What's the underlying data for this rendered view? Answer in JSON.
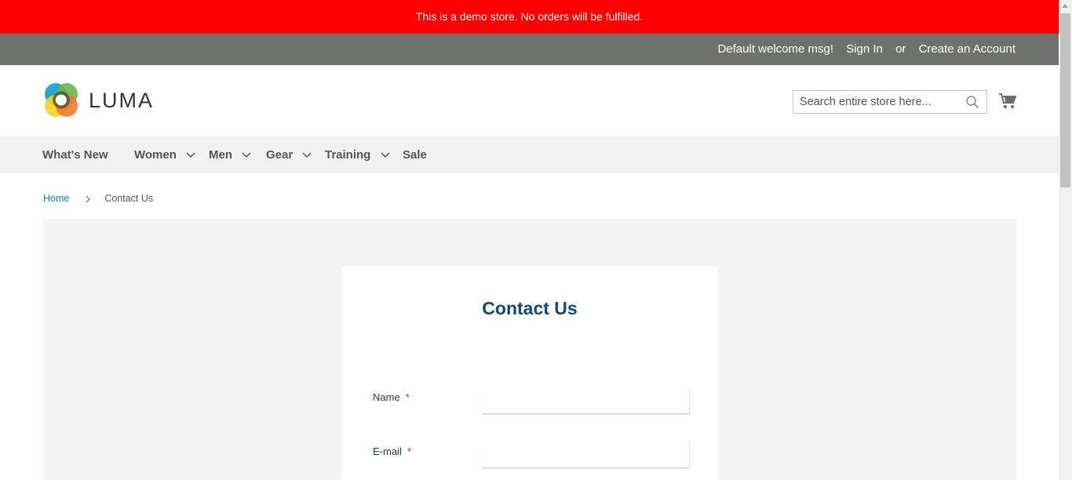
{
  "demo_notice": "This is a demo store. No orders will be fulfilled.",
  "top_links": {
    "welcome": "Default welcome msg!",
    "sign_in": "Sign In",
    "or": "or",
    "create_account": "Create an Account"
  },
  "header": {
    "logo_text": "LUMA",
    "search_placeholder": "Search entire store here..."
  },
  "nav": {
    "items": [
      {
        "label": "What's New"
      },
      {
        "label": "Women"
      },
      {
        "label": "Men"
      },
      {
        "label": "Gear"
      },
      {
        "label": "Training"
      },
      {
        "label": "Sale"
      }
    ]
  },
  "breadcrumb": {
    "home": "Home",
    "current": "Contact Us"
  },
  "form": {
    "title": "Contact Us",
    "fields": [
      {
        "label": "Name",
        "required": "*"
      },
      {
        "label": "E-mail",
        "required": "*"
      }
    ]
  },
  "colors": {
    "demo_bar": "#ff0000",
    "top_bar": "#6e716e",
    "link": "#1979c3",
    "title": "#0b4a7a",
    "required": "#e02b27"
  },
  "icons": [
    "search-icon",
    "cart-icon",
    "chevron-down-icon",
    "chevron-right-icon"
  ]
}
